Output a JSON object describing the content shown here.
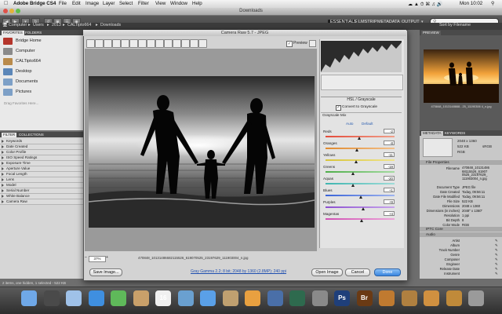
{
  "menubar": {
    "app_name": "Adobe Bridge CS4",
    "items": [
      "File",
      "Edit",
      "Image",
      "Layer",
      "Select",
      "Filter",
      "View",
      "Window",
      "Help"
    ],
    "clock": "Mon 10:02"
  },
  "bridge": {
    "window_title": "Downloads",
    "workspaces": [
      "ESSENTIALS",
      "FILMSTRIP",
      "METADATA",
      "OUTPUT"
    ],
    "active_workspace": "ESSENTIALS",
    "search_placeholder": "",
    "breadcrumbs": [
      "Computer",
      "Users",
      "2013",
      "CALTipto664",
      "Downloads"
    ],
    "sort_label": "Sort by Filename",
    "left_tabs": [
      "FAVORITES",
      "FOLDERS"
    ],
    "favorites": [
      {
        "label": "Bridge Home",
        "icon": "bridge-home-icon",
        "color": "#b4352b"
      },
      {
        "label": "Computer",
        "icon": "computer-icon",
        "color": "#8a8a8a"
      },
      {
        "label": "CALTipto664",
        "icon": "home-folder-icon",
        "color": "#b98a4b"
      },
      {
        "label": "Desktop",
        "icon": "desktop-icon",
        "color": "#5b86b8"
      },
      {
        "label": "Documents",
        "icon": "documents-icon",
        "color": "#7da0c7"
      },
      {
        "label": "Pictures",
        "icon": "pictures-icon",
        "color": "#7da0c7"
      }
    ],
    "favorites_hint": "Drag Favorites Here...",
    "filter_tabs": [
      "FILTER",
      "COLLECTIONS"
    ],
    "filters": [
      "Keywords",
      "Date Created",
      "Color Profile",
      "ISO Speed Ratings",
      "Exposure Time",
      "Aperture Value",
      "Focal Length",
      "Lens",
      "Model",
      "Serial Number",
      "White Balance",
      "Camera Raw"
    ],
    "status_text": "2 items, one hidden, 1 selected - 522 KB",
    "preview_tab": "PREVIEW",
    "thumb_caption": "470848_1013148668...25_11190306 4_n.jpg",
    "metadata_tabs": [
      "METADATA",
      "KEYWORDS"
    ],
    "metadata_summary": {
      "dims": "2048 x 1360",
      "size": "522 KB",
      "color": "sRGB",
      "depth": "RGB"
    },
    "file_properties_header": "File Properties",
    "file_properties": [
      {
        "k": "Filename",
        "v": "470848_10131486 68115526_61907 0525_23197629_ 111903004_n.jpg"
      },
      {
        "k": "Document Type",
        "v": "JPEG file"
      },
      {
        "k": "Date Created",
        "v": "Today, 09:56:11"
      },
      {
        "k": "Date File Modified",
        "v": "Today, 09:56:11"
      },
      {
        "k": "File Size",
        "v": "522 KB"
      },
      {
        "k": "Dimensions",
        "v": "2048 x 1360"
      },
      {
        "k": "Dimensions (in inches)",
        "v": "2048\" x 1360\""
      },
      {
        "k": "Resolution",
        "v": "1 ppi"
      },
      {
        "k": "Bit Depth",
        "v": "8"
      },
      {
        "k": "Color Mode",
        "v": "RGB"
      },
      {
        "k": "Color Profile",
        "v": "sRGB IEC 61966-2.1"
      }
    ],
    "iptc_header": "IPTC Core",
    "audio_header": "Audio",
    "audio_fields": [
      "Artist",
      "Album",
      "Track Number",
      "Genre",
      "Composer",
      "Engineer",
      "Release Date",
      "Instrument"
    ]
  },
  "camera_raw": {
    "title": "Camera Raw 5.7  -  JPEG",
    "preview_label": "Preview",
    "panel_title": "HSL / Grayscale",
    "convert_label": "Convert to Grayscale",
    "mix_header": "Grayscale Mix",
    "auto_label": "Auto",
    "default_label": "Default",
    "sliders": [
      {
        "label": "Reds",
        "value": "-2",
        "pos": 0.49,
        "from": "#e44b3a",
        "to": "#f0a08a"
      },
      {
        "label": "Oranges",
        "value": "-8",
        "pos": 0.46,
        "from": "#e08a2e",
        "to": "#f3c08a"
      },
      {
        "label": "Yellows",
        "value": "-11",
        "pos": 0.44,
        "from": "#d8c43a",
        "to": "#efe48c"
      },
      {
        "label": "Greens",
        "value": "-19",
        "pos": 0.4,
        "from": "#4fae4a",
        "to": "#a4dba0"
      },
      {
        "label": "Aquas",
        "value": "-20",
        "pos": 0.4,
        "from": "#3fb5b0",
        "to": "#9fdcd8"
      },
      {
        "label": "Blues",
        "value": "+1",
        "pos": 0.51,
        "from": "#3a64d8",
        "to": "#9fb4ef"
      },
      {
        "label": "Purples",
        "value": "+9",
        "pos": 0.55,
        "from": "#8b4fd0",
        "to": "#c8a5ec"
      },
      {
        "label": "Magentas",
        "value": "+4",
        "pos": 0.52,
        "from": "#d04fb3",
        "to": "#eca5d9"
      }
    ],
    "zoom_value": "37%",
    "filename": "470848_10131486682115526_619070525_23197629_111903004_n.jpg",
    "workflow_link": "Gray Gamma 2.2; 8 bit; 2048 by 1360 (2.8MP); 240 ppi",
    "save_label": "Save Image...",
    "open_label": "Open Image",
    "cancel_label": "Cancel",
    "done_label": "Done"
  },
  "dock": {
    "icons": [
      "finder-icon",
      "dashboard-icon",
      "mail-icon",
      "safari-icon",
      "ichat-icon",
      "address-book-icon",
      "ical-icon",
      "iphoto-icon",
      "itunes-icon",
      "imovie-icon",
      "garageband-icon",
      "spaces-icon",
      "time-machine-icon",
      "system-preferences-icon",
      "photoshop-icon",
      "bridge-icon",
      "thumbnail-1",
      "thumbnail-2",
      "thumbnail-3",
      "thumbnail-4",
      "trash-icon"
    ]
  }
}
